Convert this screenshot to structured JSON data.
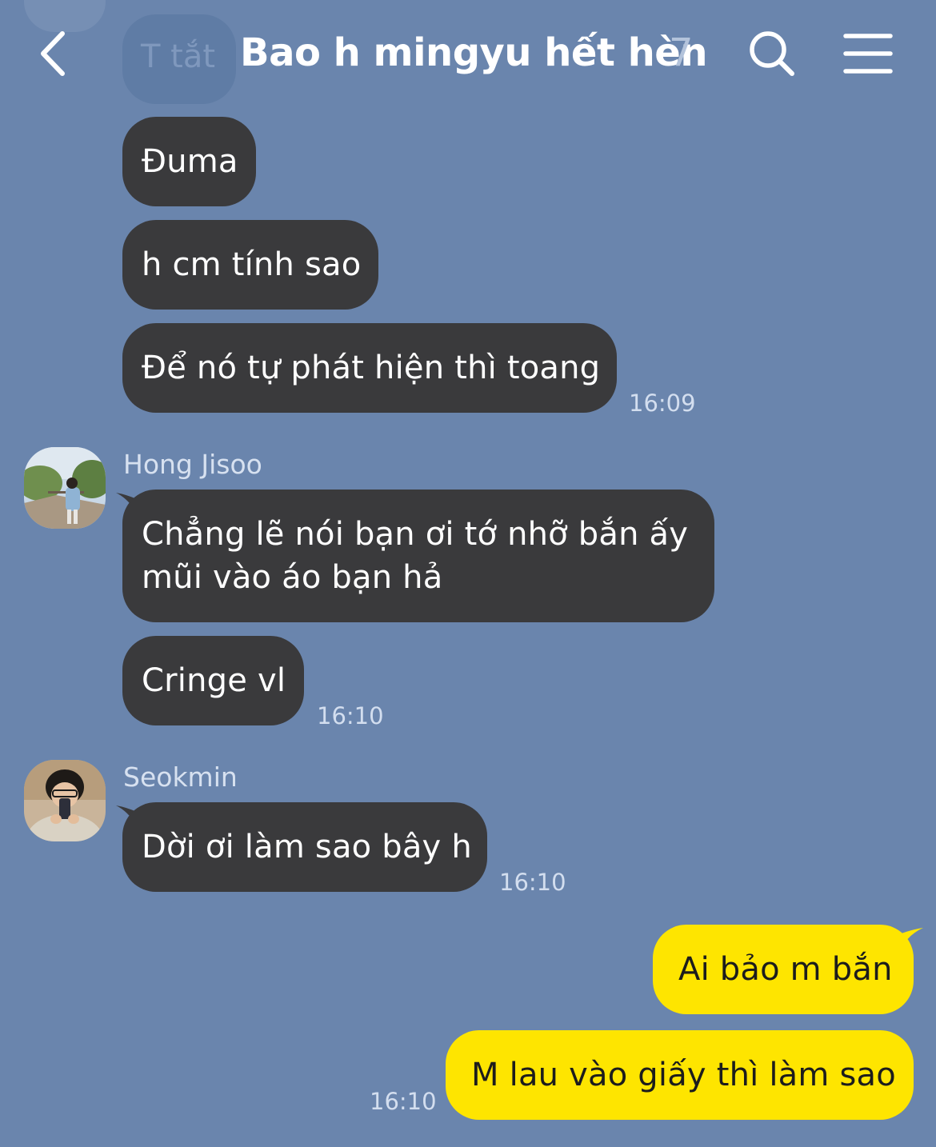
{
  "header": {
    "title": "Bao h mingyu hết hèn",
    "member_count": "7",
    "back_icon": "chevron-left-icon",
    "search_icon": "search-icon",
    "menu_icon": "hamburger-menu-icon"
  },
  "colors": {
    "background": "#6a85ad",
    "incoming_bubble": "#3a3a3c",
    "outgoing_bubble": "#fee500",
    "timestamp": "#d3deef"
  },
  "messages": {
    "ghost_text": "T tắt",
    "m1": "Đuma",
    "m2": "h cm tính sao",
    "m3": "Để nó tự phát hiện thì toang",
    "m3_time": "16:09",
    "sender2": "Hong Jisoo",
    "m4_line1": "Chẳng lẽ nói bạn ơi tớ nhỡ bắn ấy",
    "m4_line2": "mũi vào áo bạn hả",
    "m5": "Cringe vl",
    "m5_time": "16:10",
    "sender3": "Seokmin",
    "m6": "Dời ơi làm sao bây h",
    "m6_time": "16:10",
    "m7": "Ai bảo m bắn",
    "m8": "M lau vào giấy thì làm sao",
    "m8_time": "16:10"
  }
}
